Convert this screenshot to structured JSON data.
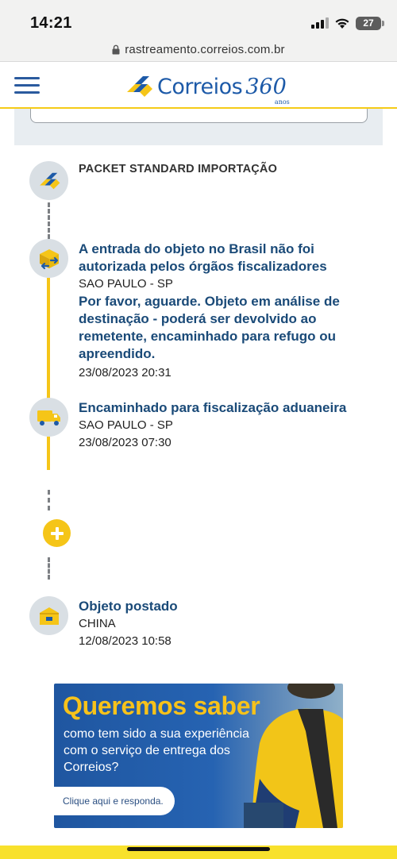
{
  "status_bar": {
    "time": "14:21",
    "battery": "27"
  },
  "browser": {
    "url": "rastreamento.correios.com.br"
  },
  "header": {
    "logo_text": "Correios",
    "logo_360": "360",
    "logo_anos": "anos",
    "menu_icon": "hamburger-menu-icon"
  },
  "tracking": {
    "service_type": "PACKET STANDARD IMPORTAÇÃO",
    "events": [
      {
        "title_lines": [
          "A entrada do objeto no Brasil não foi",
          "autorizada pelos órgãos fiscalizadores"
        ],
        "location": "SAO PAULO - SP",
        "note_lines": [
          "Por favor, aguarde. Objeto em análise de",
          "destinação - poderá ser devolvido ao",
          "remetente, encaminhado para refugo ou",
          "apreendido."
        ],
        "datetime": "23/08/2023 20:31",
        "icon": "package-return-icon"
      },
      {
        "title_lines": [
          "Encaminhado para fiscalização aduaneira"
        ],
        "location": "SAO PAULO - SP",
        "datetime": "23/08/2023 07:30",
        "icon": "delivery-truck-icon"
      },
      {
        "title_lines": [
          "Objeto postado"
        ],
        "location": "CHINA",
        "datetime": "12/08/2023 10:58",
        "icon": "post-office-icon"
      }
    ]
  },
  "banner": {
    "headline": "Queremos saber",
    "text_lines": [
      "como tem sido a sua experiência",
      "com o serviço de entrega dos",
      "Correios?"
    ],
    "button_label": "Clique aqui e responda."
  },
  "colors": {
    "brand_blue": "#1d5aa8",
    "title_blue": "#1a4a78",
    "brand_yellow": "#f5c518",
    "icon_bg": "#d9dfe4"
  }
}
